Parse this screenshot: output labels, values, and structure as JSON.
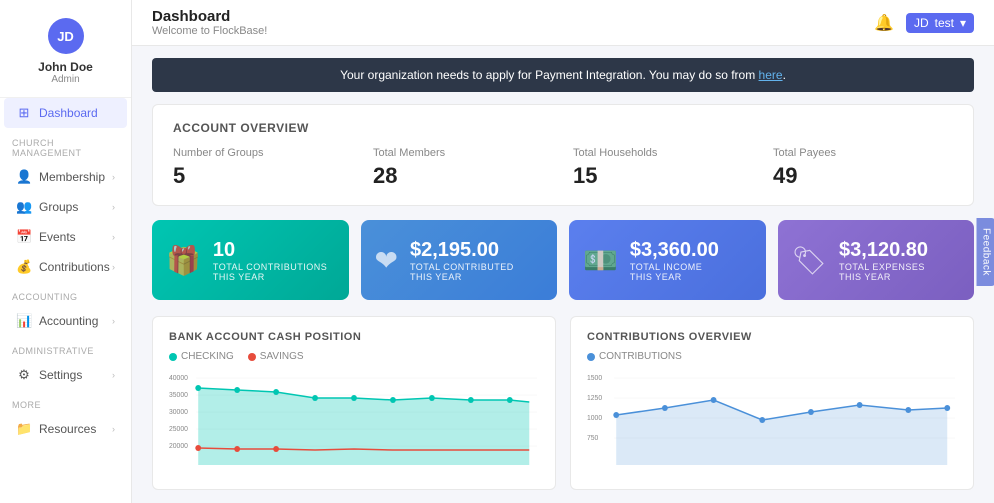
{
  "sidebar": {
    "avatar_initials": "JD",
    "username": "John Doe",
    "role": "Admin",
    "sections": [
      {
        "label": "",
        "items": [
          {
            "id": "dashboard",
            "label": "Dashboard",
            "icon": "⊞",
            "active": true,
            "has_chevron": false
          }
        ]
      },
      {
        "label": "CHURCH MANAGEMENT",
        "items": [
          {
            "id": "membership",
            "label": "Membership",
            "icon": "👤",
            "active": false,
            "has_chevron": true
          },
          {
            "id": "groups",
            "label": "Groups",
            "icon": "👥",
            "active": false,
            "has_chevron": true
          },
          {
            "id": "events",
            "label": "Events",
            "icon": "📅",
            "active": false,
            "has_chevron": true
          },
          {
            "id": "contributions",
            "label": "Contributions",
            "icon": "💰",
            "active": false,
            "has_chevron": true
          }
        ]
      },
      {
        "label": "ACCOUNTING",
        "items": [
          {
            "id": "accounting",
            "label": "Accounting",
            "icon": "📊",
            "active": false,
            "has_chevron": true
          }
        ]
      },
      {
        "label": "ADMINISTRATIVE",
        "items": [
          {
            "id": "settings",
            "label": "Settings",
            "icon": "⚙",
            "active": false,
            "has_chevron": true
          }
        ]
      },
      {
        "label": "MORE",
        "items": [
          {
            "id": "resources",
            "label": "Resources",
            "icon": "📁",
            "active": false,
            "has_chevron": true
          }
        ]
      }
    ]
  },
  "topbar": {
    "title": "Dashboard",
    "subtitle": "Welcome to FlockBase!",
    "user_initials": "JD",
    "user_label": "test"
  },
  "banner": {
    "text": "Your organization needs to apply for Payment Integration. You may do so from ",
    "link_text": "here",
    "trailing": "."
  },
  "account_overview": {
    "title": "ACCOUNT OVERVIEW",
    "stats": [
      {
        "label": "Number of Groups",
        "value": "5"
      },
      {
        "label": "Total Members",
        "value": "28"
      },
      {
        "label": "Total Households",
        "value": "15"
      },
      {
        "label": "Total Payees",
        "value": "49"
      }
    ]
  },
  "stat_cards": [
    {
      "value": "10",
      "label": "TOTAL CONTRIBUTIONS\nTHIS YEAR",
      "icon": "🎁",
      "class": "stat-card-1"
    },
    {
      "value": "$2,195.00",
      "label": "TOTAL CONTRIBUTED\nTHIS YEAR",
      "icon": "❤",
      "class": "stat-card-2"
    },
    {
      "value": "$3,360.00",
      "label": "TOTAL INCOME\nTHIS YEAR",
      "icon": "💵",
      "class": "stat-card-3"
    },
    {
      "value": "$3,120.80",
      "label": "TOTAL EXPENSES\nTHIS YEAR",
      "icon": "🏷",
      "class": "stat-card-4"
    }
  ],
  "charts": {
    "bank": {
      "title": "BANK ACCOUNT CASH POSITION",
      "legend": [
        {
          "label": "CHECKING",
          "color": "#00c6b2"
        },
        {
          "label": "SAVINGS",
          "color": "#e74c3c"
        }
      ]
    },
    "contributions": {
      "title": "CONTRIBUTIONS OVERVIEW",
      "legend": [
        {
          "label": "CONTRIBUTIONS",
          "color": "#4a90d9"
        }
      ]
    }
  },
  "feedback": {
    "label": "Feedback"
  }
}
